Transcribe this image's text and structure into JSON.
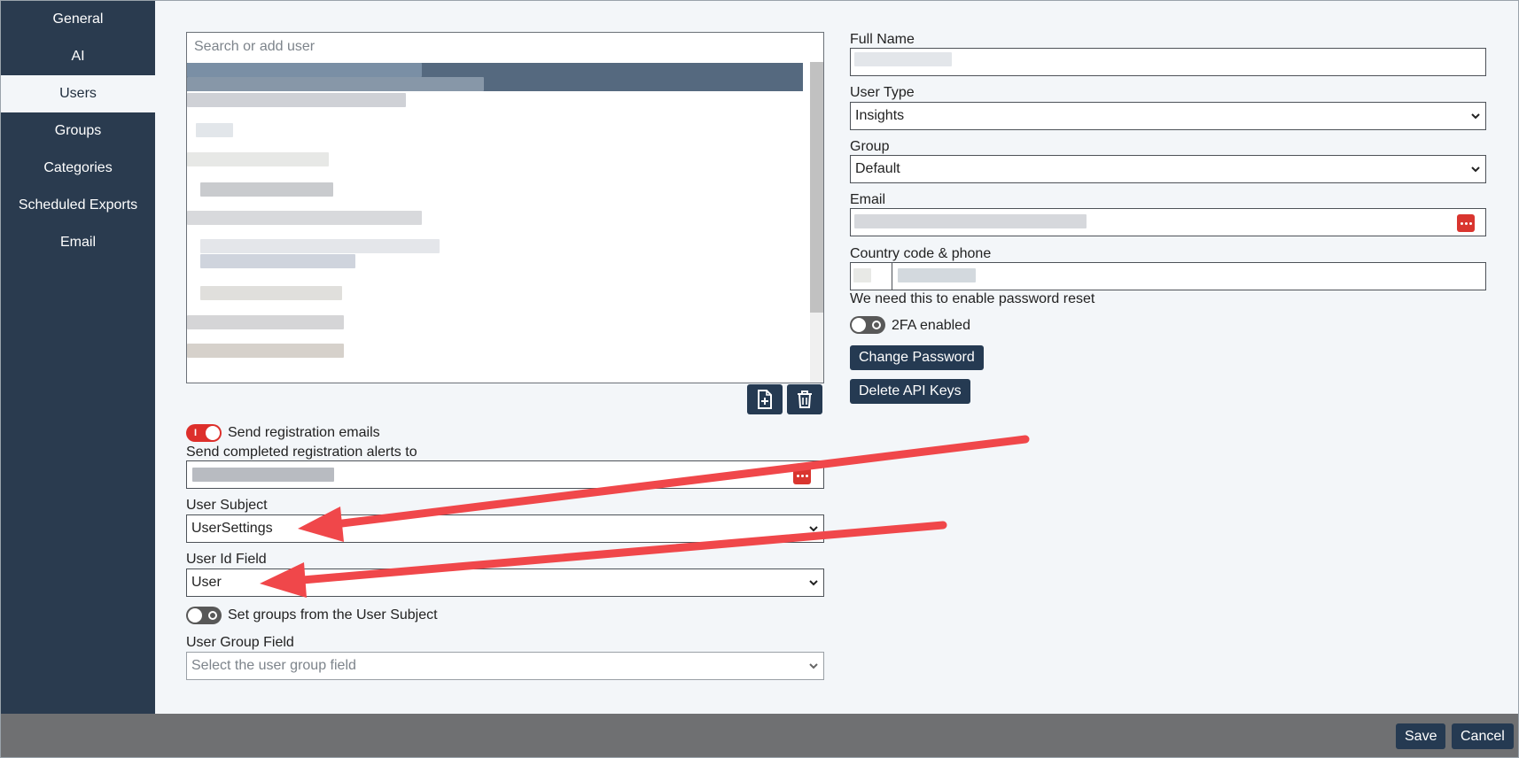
{
  "sidebar": {
    "items": [
      {
        "label": "General"
      },
      {
        "label": "AI"
      },
      {
        "label": "Users"
      },
      {
        "label": "Groups"
      },
      {
        "label": "Categories"
      },
      {
        "label": "Scheduled Exports"
      },
      {
        "label": "Email"
      }
    ],
    "active": "Users"
  },
  "user_list": {
    "search_placeholder": "Search or add user",
    "add_icon": "file-plus-icon",
    "delete_icon": "trash-icon"
  },
  "registration": {
    "send_emails_label": "Send registration emails",
    "send_emails_enabled": true,
    "alerts_label": "Send completed registration alerts to"
  },
  "user_subject": {
    "label": "User Subject",
    "value": "UserSettings"
  },
  "user_id_field": {
    "label": "User Id Field",
    "value": "User"
  },
  "set_groups": {
    "label": "Set groups from the User Subject",
    "enabled": false
  },
  "user_group_field": {
    "label": "User Group Field",
    "placeholder": "Select the user group field"
  },
  "details": {
    "full_name_label": "Full Name",
    "user_type_label": "User Type",
    "user_type_value": "Insights",
    "group_label": "Group",
    "group_value": "Default",
    "email_label": "Email",
    "phone_label": "Country code & phone",
    "phone_helper": "We need this to enable password reset",
    "twofa_label": "2FA enabled",
    "twofa_enabled": false,
    "change_password_label": "Change Password",
    "delete_api_keys_label": "Delete API Keys"
  },
  "footer": {
    "save_label": "Save",
    "cancel_label": "Cancel"
  },
  "colors": {
    "sidebar_bg": "#2a3b4f",
    "button_bg": "#253a52",
    "toggle_on": "#dd2f2b",
    "annotation_arrow": "#f0474a"
  }
}
